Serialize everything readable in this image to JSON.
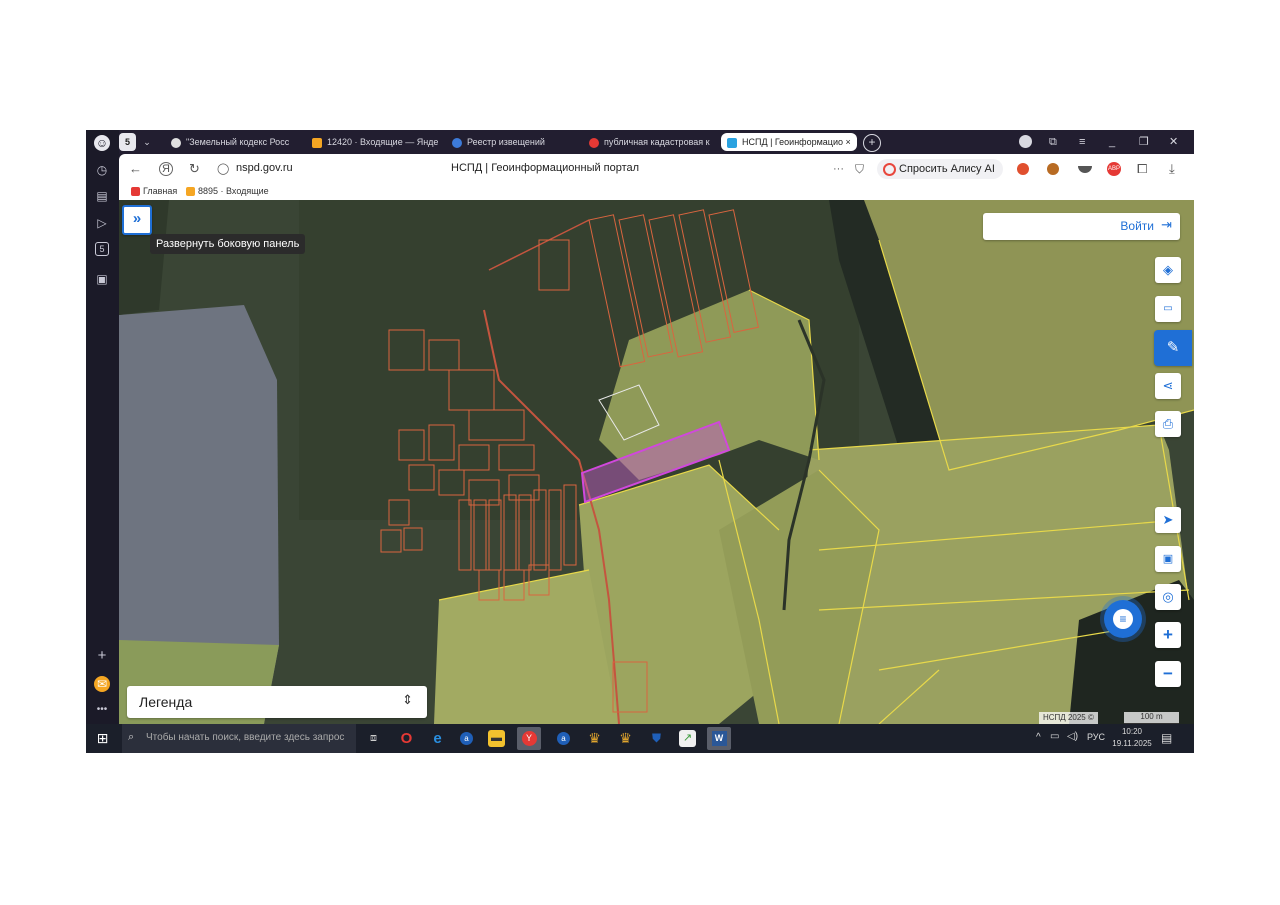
{
  "browser": {
    "tabs": [
      {
        "label": "\"Земельный кодекс Росс",
        "color": "#e0e0e0"
      },
      {
        "label": "12420 · Входящие — Янде",
        "color": "#f5a623"
      },
      {
        "label": "Реестр извещений",
        "color": "#3d7bd9"
      },
      {
        "label": "публичная кадастровая к",
        "color": "#e53935"
      },
      {
        "label": "НСПД | Геоинформацио",
        "color": "#2aa2e0"
      }
    ],
    "tab_close": "×",
    "new_tab": "+",
    "url": "nspd.gov.ru",
    "page_title": "НСПД | Геоинформационный портал",
    "more_dots": "···",
    "alice_label": "Спросить Алису AI",
    "bookmarks": [
      {
        "label": "Главная",
        "color": "#e53935"
      },
      {
        "label": "8895 · Входящие",
        "color": "#f5a623"
      }
    ]
  },
  "map": {
    "expand_button": "»",
    "expand_tooltip": "Развернуть боковую панель",
    "login_label": "Войти",
    "legend_label": "Легенда",
    "attribution": "НСПД 2025 ©",
    "scale_label": "100 m",
    "zoom_in": "+",
    "zoom_out": "−",
    "accent_color": "#1f6fd6"
  },
  "taskbar": {
    "search_placeholder": "Чтобы начать поиск, введите здесь запрос",
    "lang": "РУС",
    "time": "10:20",
    "date": "19.11.2025"
  }
}
